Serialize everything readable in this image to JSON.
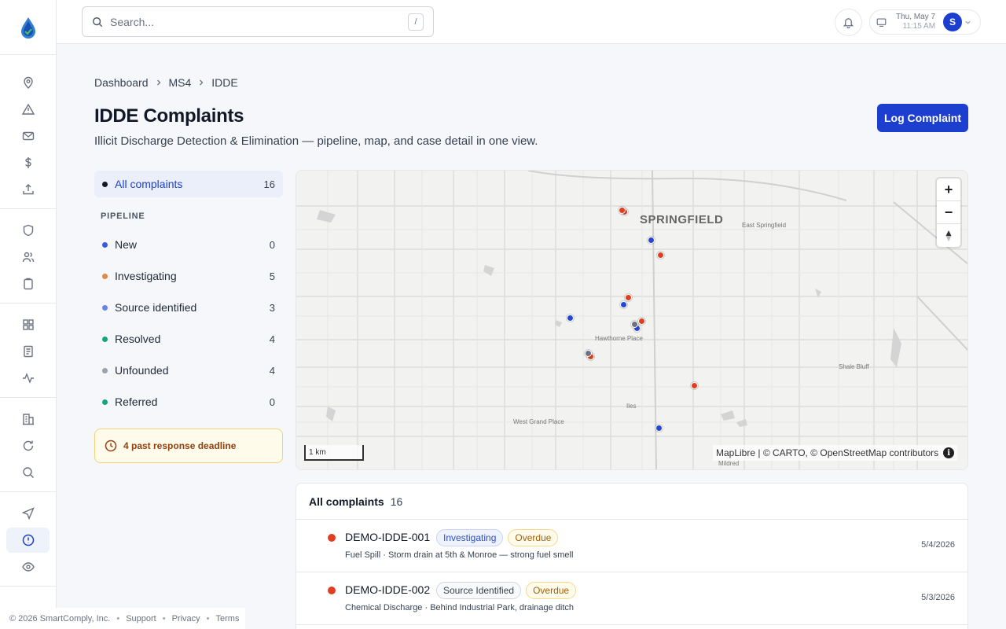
{
  "topbar": {
    "search_placeholder": "Search...",
    "search_shortcut": "/",
    "date": "Thu, May 7",
    "time": "11:15 AM",
    "avatar_initial": "S"
  },
  "breadcrumb": [
    "Dashboard",
    "MS4",
    "IDDE"
  ],
  "page": {
    "title": "IDDE Complaints",
    "subtitle": "Illicit Discharge Detection & Elimination — pipeline, map, and case detail in one view.",
    "primary_button": "Log Complaint"
  },
  "filters": {
    "all": {
      "label": "All complaints",
      "count": "16",
      "color": "#111827"
    },
    "pipeline_heading": "PIPELINE",
    "pipeline": [
      {
        "label": "New",
        "count": "0",
        "color": "#3b5bdb"
      },
      {
        "label": "Investigating",
        "count": "5",
        "color": "#dd8a4a"
      },
      {
        "label": "Source identified",
        "count": "3",
        "color": "#6b83e6"
      },
      {
        "label": "Resolved",
        "count": "4",
        "color": "#16a37f"
      },
      {
        "label": "Unfounded",
        "count": "4",
        "color": "#9ca3af"
      },
      {
        "label": "Referred",
        "count": "0",
        "color": "#16a37f"
      }
    ],
    "deadline_notice": "4 past response deadline"
  },
  "map": {
    "city_label": "SPRINGFIELD",
    "place_labels": [
      "East Springfield",
      "Hawthorne Place",
      "Shale Bluff",
      "Iles",
      "West Grand Place",
      "Mildred"
    ],
    "zoom_in": "+",
    "zoom_out": "−",
    "scale_label": "1 km",
    "attribution": "MapLibre | © CARTO, © OpenStreetMap contributors",
    "pin_colors": {
      "red": "#e03e1f",
      "blue": "#2746d6",
      "gray": "#6b7280"
    }
  },
  "list": {
    "heading": "All complaints",
    "count": "16",
    "rows": [
      {
        "id": "DEMO-IDDE-001",
        "status": "Investigating",
        "flag": "Overdue",
        "desc": "Fuel Spill · Storm drain at 5th & Monroe — strong fuel smell",
        "date": "5/4/2026"
      },
      {
        "id": "DEMO-IDDE-002",
        "status": "Source Identified",
        "flag": "Overdue",
        "desc": "Chemical Discharge · Behind Industrial Park, drainage ditch",
        "date": "5/3/2026"
      }
    ]
  },
  "footer": {
    "copyright": "© 2026 SmartComply, Inc.",
    "links": [
      "Support",
      "Privacy",
      "Terms"
    ]
  }
}
